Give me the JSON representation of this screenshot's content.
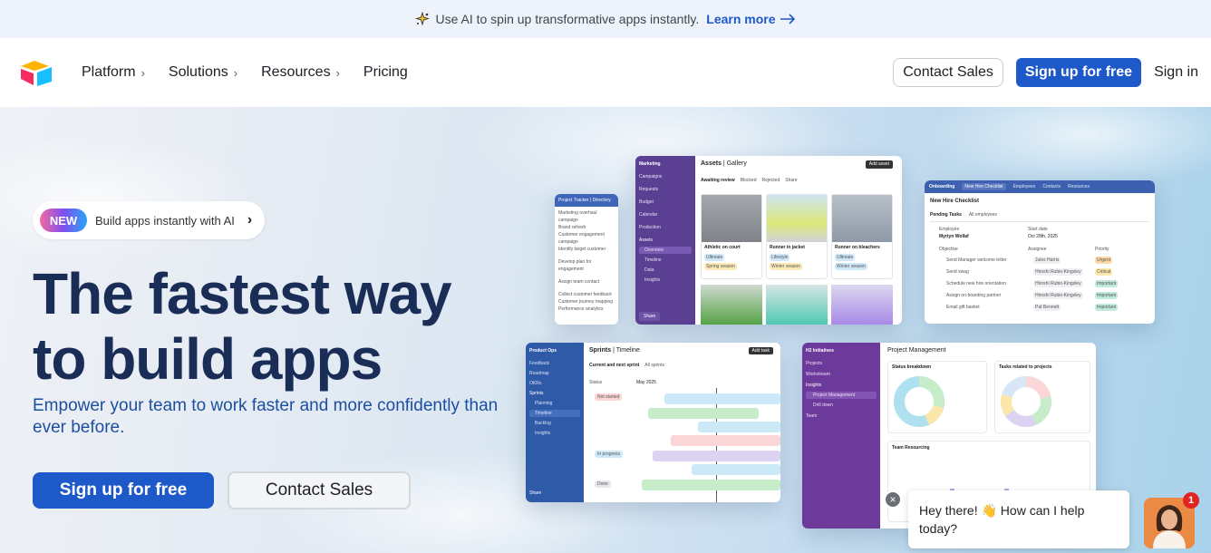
{
  "announcement": {
    "text": "Use AI to spin up transformative apps instantly.",
    "link": "Learn more"
  },
  "nav": {
    "items": [
      {
        "label": "Platform",
        "has_chevron": true
      },
      {
        "label": "Solutions",
        "has_chevron": true
      },
      {
        "label": "Resources",
        "has_chevron": true
      },
      {
        "label": "Pricing",
        "has_chevron": false
      }
    ],
    "contact_sales": "Contact Sales",
    "signup": "Sign up for free",
    "signin": "Sign in"
  },
  "hero": {
    "badge": "NEW",
    "pill_text": "Build apps instantly with AI",
    "headline_line1": "The fastest way",
    "headline_line2": "to build apps",
    "subhead": "Empower your team to work faster and more confidently than ever before.",
    "cta_primary": "Sign up for free",
    "cta_secondary": "Contact Sales"
  },
  "mockups": {
    "marketing": {
      "workspace": "Marketing",
      "title": "Assets",
      "view": "Gallery",
      "button": "Add asset",
      "tabs": [
        "Awaiting review",
        "Blocked",
        "Rejected",
        "Share"
      ],
      "sidebar": [
        "Campaigns",
        "Requests",
        "Budget",
        "Calendar",
        "Production",
        "Assets",
        "Overview",
        "Timeline",
        "Data",
        "Insights"
      ],
      "cards": [
        {
          "name": "Athletic on court",
          "tags": [
            "Ultimate",
            "Spring season"
          ]
        },
        {
          "name": "Runner in jacket",
          "tags": [
            "Lifestyle",
            "Winter season"
          ]
        },
        {
          "name": "Runner on bleachers",
          "tags": [
            "Ultimate",
            "Winter season"
          ]
        }
      ],
      "share": "Share"
    },
    "project_tracker": {
      "title": "Project Tracker",
      "view": "Directory",
      "items": [
        "Marketing overhaul campaign",
        "Brand refresh",
        "Customer engagement campaign",
        "Identify target customer",
        "Develop plan for engagement",
        "Assign team contact",
        "Collect customer feedback",
        "Customer journey mapping",
        "Performance analytics"
      ]
    },
    "onboarding": {
      "workspace": "Onboarding",
      "tabs": [
        "New Hire Checklist",
        "Employees",
        "Contacts",
        "Resources"
      ],
      "title": "New Hire Checklist",
      "subtabs": [
        "Pending Tasks",
        "All employees"
      ],
      "employee_label": "Employee",
      "employee": "Myrtyn Wollaf",
      "start_label": "Start date",
      "start_date": "Oct 28th, 2025",
      "columns": [
        "Objective",
        "Assignee",
        "Priority"
      ],
      "rows": [
        {
          "objective": "Send Manager welcome letter",
          "assignee": "Jules Harris",
          "priority": "Urgent",
          "color": "#f6a04a"
        },
        {
          "objective": "Send swag",
          "assignee": "Hiroshi Rubio-Kingsley",
          "priority": "Critical",
          "color": "#f5c24a"
        },
        {
          "objective": "Schedule new hire orientation",
          "assignee": "Hiroshi Rubio-Kingsley",
          "priority": "Important",
          "color": "#52c4a7"
        },
        {
          "objective": "Assign on-boarding partner",
          "assignee": "Hiroshi Rubio-Kingsley",
          "priority": "Important",
          "color": "#52c4a7"
        },
        {
          "objective": "Email gift basket",
          "assignee": "Pat Bennett",
          "priority": "Important",
          "color": "#52c4a7"
        }
      ]
    },
    "product_ops": {
      "workspace": "Product Ops",
      "title": "Sprints",
      "view": "Timeline",
      "button": "Add task",
      "tabs": [
        "Current and next sprint",
        "All sprints"
      ],
      "sidebar": [
        "Feedback",
        "Roadmap",
        "OKRs",
        "Sprints",
        "Planning",
        "Timeline",
        "Backlog",
        "Insights"
      ],
      "col_status": "Status",
      "month": "May 2025",
      "statuses": [
        "Not started",
        "In progress",
        "Done"
      ],
      "share": "Share"
    },
    "initiatives": {
      "workspace": "H2 Initiatives",
      "title": "Project Management",
      "sidebar": [
        "Projects",
        "Workstream",
        "Insights",
        "Project Management",
        "Drill down",
        "Team"
      ],
      "panel1": "Status breakdown",
      "panel2": "Tasks related to projects",
      "panel3": "Team Resourcing"
    }
  },
  "chat": {
    "message": "Hey there! 👋 How can I help today?",
    "badge_count": "1"
  },
  "colors": {
    "primary": "#1d59c9",
    "headline": "#1a2d57",
    "subhead": "#1d4fa0"
  }
}
